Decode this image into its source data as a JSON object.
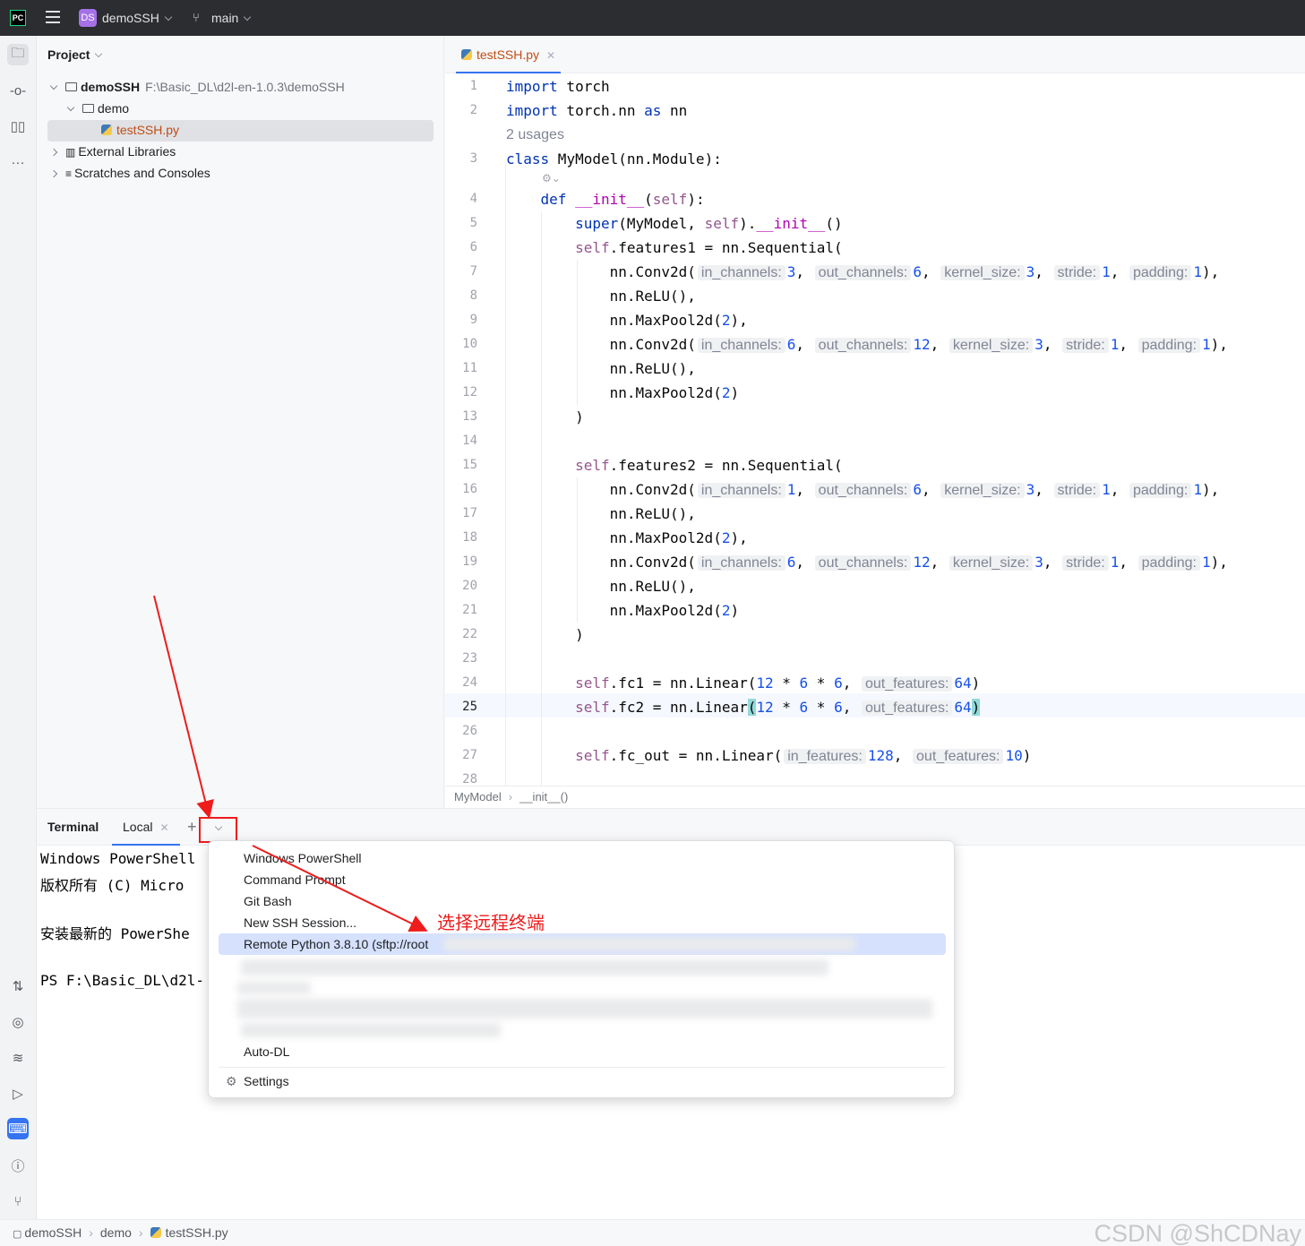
{
  "titlebar": {
    "logo": "PC",
    "project_badge": "DS",
    "project_name": "demoSSH",
    "branch": "main"
  },
  "project_panel": {
    "title": "Project",
    "tree": {
      "root_name": "demoSSH",
      "root_path": "F:\\Basic_DL\\d2l-en-1.0.3\\demoSSH",
      "folder": "demo",
      "file": "testSSH.py",
      "external": "External Libraries",
      "scratches": "Scratches and Consoles"
    }
  },
  "editor": {
    "tab_label": "testSSH.py",
    "usages": "2 usages",
    "line_numbers": [
      "1",
      "2",
      "3",
      "4",
      "5",
      "6",
      "7",
      "8",
      "9",
      "10",
      "11",
      "12",
      "13",
      "14",
      "15",
      "16",
      "17",
      "18",
      "19",
      "20",
      "21",
      "22",
      "23",
      "24",
      "25",
      "26",
      "27",
      "28"
    ],
    "current_line": "25",
    "breadcrumb": [
      "MyModel",
      "__init__()"
    ],
    "hints": {
      "in_channels": "in_channels:",
      "out_channels": "out_channels:",
      "kernel_size": "kernel_size:",
      "stride": "stride:",
      "padding": "padding:",
      "out_features": "out_features:",
      "in_features": "in_features:"
    }
  },
  "terminal": {
    "title": "Terminal",
    "tab_local": "Local",
    "lines": [
      "Windows PowerShell",
      "版权所有 (C) Micro",
      "安装最新的 PowerShe",
      "PS F:\\Basic_DL\\d2l-"
    ]
  },
  "dropdown": {
    "items": [
      "Windows PowerShell",
      "Command Prompt",
      "Git Bash",
      "New SSH Session...",
      "Remote Python 3.8.10 (sftp://root"
    ],
    "auto_dl": "Auto-DL",
    "settings": "Settings"
  },
  "annotation": "选择远程终端",
  "statusbar": {
    "crumbs": [
      "demoSSH",
      "demo",
      "testSSH.py"
    ],
    "watermark": "CSDN @ShCDNay"
  },
  "colors": {
    "accent": "#3574f0",
    "annotation_red": "#ee1c1c",
    "keyword": "#0033b3",
    "self": "#94558d",
    "number": "#1750eb",
    "dunder": "#b200b2"
  }
}
